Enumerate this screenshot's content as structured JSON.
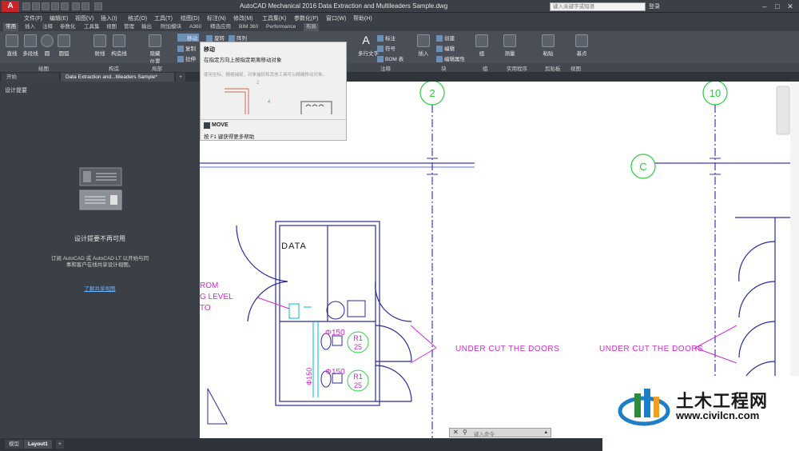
{
  "app": {
    "logo": "A",
    "title": "AutoCAD Mechanical 2016     Data Extraction and Multileaders Sample.dwg",
    "search_placeholder": "键入关键字或短语",
    "login_label": "登录"
  },
  "menu": [
    "文件(F)",
    "编辑(E)",
    "视图(V)",
    "插入(I)",
    "格式(O)",
    "工具(T)",
    "绘图(D)",
    "标注(N)",
    "修改(M)",
    "工具集(K)",
    "参数化(P)",
    "窗口(W)",
    "帮助(H)"
  ],
  "ribbon_tabs": [
    "常用",
    "插入",
    "注释",
    "参数化",
    "工具集",
    "视图",
    "管理",
    "输出",
    "附加模块",
    "A360",
    "精选应用",
    "BIM 360",
    "Performance",
    "布局"
  ],
  "ribbon": {
    "draw_tools": [
      "直线",
      "多段线",
      "圆",
      "圆弧"
    ],
    "snap_tools": [
      "射线",
      "构造线"
    ],
    "modify_small": [
      "移动",
      "旋转",
      "阵列",
      "复制",
      "拉伸"
    ],
    "layer_tools": [
      "隐藏",
      "位置"
    ],
    "annot_tools": [
      "多行文字"
    ],
    "annot_small": [
      "标注",
      "符号",
      "BOM 表"
    ],
    "block_tools": [
      "插入"
    ],
    "block_small": [
      "创建",
      "编辑",
      "编辑属性"
    ],
    "group_tools": [
      "组"
    ],
    "util_tools": [
      "测量"
    ],
    "clip_tools": [
      "粘贴"
    ],
    "base_tools": [
      "基点"
    ],
    "panel_labels": [
      "绘图",
      "构造",
      "局部",
      "注释",
      "块",
      "组",
      "实用程序",
      "剪贴板",
      "视图"
    ]
  },
  "doc_tabs": [
    "开始",
    "Data Extraction and...ltileaders Sample*"
  ],
  "left_panel": {
    "title": "设计提要",
    "unavailable": "设计提要不再可用",
    "desc_line1": "订阅 AutoCAD 或 AutoCAD LT 以开始与同",
    "desc_line2": "事和客户在线共享设计视图。",
    "link": "了解共享视图"
  },
  "tooltip": {
    "title": "移动",
    "description": "在指定方向上按指定距离移动对象",
    "sub": "使用坐标、栅格捕捉、对象捕捉和其他工具可以精确移动对象。",
    "command": "MOVE",
    "help": "按 F1 键获得更多帮助",
    "figure_labels": [
      "2",
      "4"
    ]
  },
  "drawing": {
    "grid_labels": [
      "2",
      "10",
      "C"
    ],
    "room_label": "DATA",
    "annotation_left": [
      "ROM",
      "G LEVEL",
      "TO"
    ],
    "annotation_right": "UNDER CUT THE DOORS",
    "dims": [
      "Φ150",
      "Φ150",
      "R1",
      "25",
      "R1",
      "25",
      "Φ150"
    ]
  },
  "command_line": {
    "placeholder": "键入命令"
  },
  "layout_tabs": [
    "模型",
    "Layout1"
  ],
  "watermark": {
    "title": "土木工程网",
    "url": "www.civilcn.com"
  },
  "colors": {
    "grid_bubble": "#2ecc40",
    "grid_line": "#3a3ab8",
    "wall": "#2a2a9c",
    "magenta": "#d12ad1",
    "cyan": "#00b8d4",
    "accent_red": "#c8252b"
  }
}
